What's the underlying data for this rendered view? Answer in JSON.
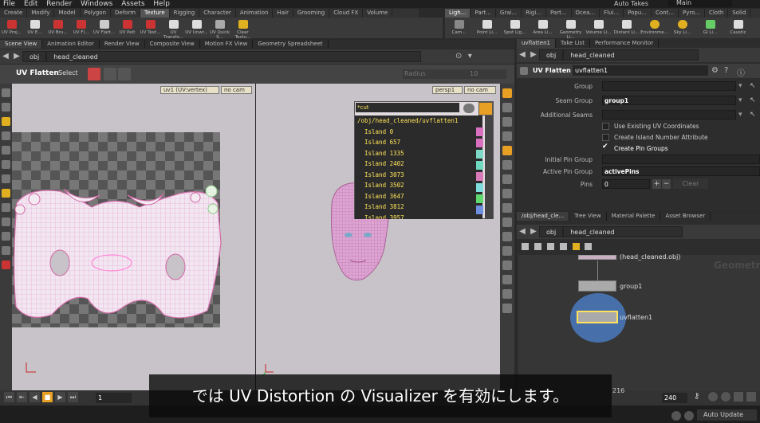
{
  "menubar": [
    "File",
    "Edit",
    "Render",
    "Windows",
    "Assets",
    "Help"
  ],
  "autotakes": "Auto Takes",
  "main": "Main",
  "shelf_tabs": [
    "Create",
    "Modify",
    "Model",
    "Polygon",
    "Deform",
    "Texture",
    "Rigging",
    "Character",
    "Animation",
    "Hair",
    "Grooming",
    "Cloud FX",
    "Volume"
  ],
  "shelf_tabs_right": [
    "Ligh...",
    "Part...",
    "Grai...",
    "Rigi...",
    "Part...",
    "Ocea...",
    "Flui...",
    "Popu...",
    "Cont...",
    "Pyro...",
    "Cloth",
    "Solid"
  ],
  "shelf_tools": [
    "UV Proj...",
    "UV E...",
    "UV Bru...",
    "UV Fl...",
    "UV Flatt...",
    "UV Pelt",
    "UV Text...",
    "UV Transfo...",
    "UV Unwr...",
    "UV Quick S...",
    "Clear Textu..."
  ],
  "shelf_tools_right": [
    "Cam...",
    "Point Li...",
    "Spot Lig...",
    "Area Li...",
    "Geometry Li...",
    "Volume Li...",
    "Distant Li...",
    "Environme...",
    "Sky Li...",
    "GI Li...",
    "Caustic"
  ],
  "pane_tabs": [
    "Scene View",
    "Animation Editor",
    "Render View",
    "Composite View",
    "Motion FX View",
    "Geometry Spreadsheet"
  ],
  "path": {
    "obj": "obj",
    "node": "head_cleaned"
  },
  "viewer_tool": {
    "title": "UV Flatten",
    "mode": "Select",
    "radius_label": "Radius",
    "radius_value": "10"
  },
  "uv_view": {
    "attr_menu": "uv1 (UV:vertex)",
    "cam_menu": "no cam"
  },
  "view3d": {
    "persp_menu": "persp1",
    "cam_menu": "no cam"
  },
  "group_popup": {
    "field": "*cut",
    "path": "/obj/head_cleaned/uvflatten1",
    "islands": [
      "Island 0",
      "Island 657",
      "Island 1335",
      "Island 2402",
      "Island 3073",
      "Island 3502",
      "Island 3647",
      "Island 3812",
      "Island 3957"
    ],
    "colors": [
      "#d96fbf",
      "#d96fbf",
      "#7dd8c8",
      "#6fd8c0",
      "#d97ab8",
      "#7fdcdc",
      "#5fd86f",
      "#6f8fe0",
      "#d0d0d0"
    ]
  },
  "right_tabs": [
    "uvflatten1",
    "Take List",
    "Performance Monitor"
  ],
  "params": {
    "node_type": "UV Flatten",
    "node_name": "uvflatten1",
    "group_label": "Group",
    "seam_group_label": "Seam Group",
    "seam_group_value": "group1",
    "additional_seams_label": "Additional Seams",
    "existing_uv": "Use Existing UV Coordinates",
    "island_attr": "Create Island Number Attribute",
    "pin_groups": "Create Pin Groups",
    "initial_pin_label": "Initial Pin Group",
    "active_pin_label": "Active Pin Group",
    "active_pin_value": "activePins",
    "pins_label": "Pins",
    "pins_value": "0",
    "plus": "+",
    "minus": "−",
    "clear": "Clear"
  },
  "net_tabs": [
    "/obj/head_cle...",
    "Tree View",
    "Material Palette",
    "Asset Browser"
  ],
  "network": {
    "context": "Geometry",
    "nodes": [
      "(head_cleaned.obj)",
      "group1",
      "uvflatten1"
    ]
  },
  "timeline": {
    "frame": "1",
    "end_frame": "216",
    "end": "240",
    "step": "1"
  },
  "subtitle": "では UV Distortion の Visualizer を有効にします。",
  "auto_update": "Auto Update",
  "colors": {
    "accent": "#e8a024",
    "island_highlight": "#ffe45a",
    "uv_wire": "#e49ad8",
    "node_selected": "#4a7ac0"
  }
}
